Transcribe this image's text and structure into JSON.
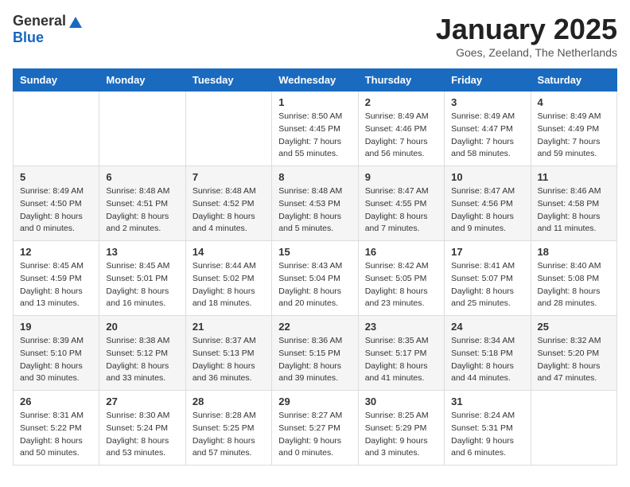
{
  "logo": {
    "general": "General",
    "blue": "Blue"
  },
  "title": "January 2025",
  "subtitle": "Goes, Zeeland, The Netherlands",
  "days_of_week": [
    "Sunday",
    "Monday",
    "Tuesday",
    "Wednesday",
    "Thursday",
    "Friday",
    "Saturday"
  ],
  "weeks": [
    [
      {
        "day": "",
        "sunrise": "",
        "sunset": "",
        "daylight": ""
      },
      {
        "day": "",
        "sunrise": "",
        "sunset": "",
        "daylight": ""
      },
      {
        "day": "",
        "sunrise": "",
        "sunset": "",
        "daylight": ""
      },
      {
        "day": "1",
        "sunrise": "Sunrise: 8:50 AM",
        "sunset": "Sunset: 4:45 PM",
        "daylight": "Daylight: 7 hours and 55 minutes."
      },
      {
        "day": "2",
        "sunrise": "Sunrise: 8:49 AM",
        "sunset": "Sunset: 4:46 PM",
        "daylight": "Daylight: 7 hours and 56 minutes."
      },
      {
        "day": "3",
        "sunrise": "Sunrise: 8:49 AM",
        "sunset": "Sunset: 4:47 PM",
        "daylight": "Daylight: 7 hours and 58 minutes."
      },
      {
        "day": "4",
        "sunrise": "Sunrise: 8:49 AM",
        "sunset": "Sunset: 4:49 PM",
        "daylight": "Daylight: 7 hours and 59 minutes."
      }
    ],
    [
      {
        "day": "5",
        "sunrise": "Sunrise: 8:49 AM",
        "sunset": "Sunset: 4:50 PM",
        "daylight": "Daylight: 8 hours and 0 minutes."
      },
      {
        "day": "6",
        "sunrise": "Sunrise: 8:48 AM",
        "sunset": "Sunset: 4:51 PM",
        "daylight": "Daylight: 8 hours and 2 minutes."
      },
      {
        "day": "7",
        "sunrise": "Sunrise: 8:48 AM",
        "sunset": "Sunset: 4:52 PM",
        "daylight": "Daylight: 8 hours and 4 minutes."
      },
      {
        "day": "8",
        "sunrise": "Sunrise: 8:48 AM",
        "sunset": "Sunset: 4:53 PM",
        "daylight": "Daylight: 8 hours and 5 minutes."
      },
      {
        "day": "9",
        "sunrise": "Sunrise: 8:47 AM",
        "sunset": "Sunset: 4:55 PM",
        "daylight": "Daylight: 8 hours and 7 minutes."
      },
      {
        "day": "10",
        "sunrise": "Sunrise: 8:47 AM",
        "sunset": "Sunset: 4:56 PM",
        "daylight": "Daylight: 8 hours and 9 minutes."
      },
      {
        "day": "11",
        "sunrise": "Sunrise: 8:46 AM",
        "sunset": "Sunset: 4:58 PM",
        "daylight": "Daylight: 8 hours and 11 minutes."
      }
    ],
    [
      {
        "day": "12",
        "sunrise": "Sunrise: 8:45 AM",
        "sunset": "Sunset: 4:59 PM",
        "daylight": "Daylight: 8 hours and 13 minutes."
      },
      {
        "day": "13",
        "sunrise": "Sunrise: 8:45 AM",
        "sunset": "Sunset: 5:01 PM",
        "daylight": "Daylight: 8 hours and 16 minutes."
      },
      {
        "day": "14",
        "sunrise": "Sunrise: 8:44 AM",
        "sunset": "Sunset: 5:02 PM",
        "daylight": "Daylight: 8 hours and 18 minutes."
      },
      {
        "day": "15",
        "sunrise": "Sunrise: 8:43 AM",
        "sunset": "Sunset: 5:04 PM",
        "daylight": "Daylight: 8 hours and 20 minutes."
      },
      {
        "day": "16",
        "sunrise": "Sunrise: 8:42 AM",
        "sunset": "Sunset: 5:05 PM",
        "daylight": "Daylight: 8 hours and 23 minutes."
      },
      {
        "day": "17",
        "sunrise": "Sunrise: 8:41 AM",
        "sunset": "Sunset: 5:07 PM",
        "daylight": "Daylight: 8 hours and 25 minutes."
      },
      {
        "day": "18",
        "sunrise": "Sunrise: 8:40 AM",
        "sunset": "Sunset: 5:08 PM",
        "daylight": "Daylight: 8 hours and 28 minutes."
      }
    ],
    [
      {
        "day": "19",
        "sunrise": "Sunrise: 8:39 AM",
        "sunset": "Sunset: 5:10 PM",
        "daylight": "Daylight: 8 hours and 30 minutes."
      },
      {
        "day": "20",
        "sunrise": "Sunrise: 8:38 AM",
        "sunset": "Sunset: 5:12 PM",
        "daylight": "Daylight: 8 hours and 33 minutes."
      },
      {
        "day": "21",
        "sunrise": "Sunrise: 8:37 AM",
        "sunset": "Sunset: 5:13 PM",
        "daylight": "Daylight: 8 hours and 36 minutes."
      },
      {
        "day": "22",
        "sunrise": "Sunrise: 8:36 AM",
        "sunset": "Sunset: 5:15 PM",
        "daylight": "Daylight: 8 hours and 39 minutes."
      },
      {
        "day": "23",
        "sunrise": "Sunrise: 8:35 AM",
        "sunset": "Sunset: 5:17 PM",
        "daylight": "Daylight: 8 hours and 41 minutes."
      },
      {
        "day": "24",
        "sunrise": "Sunrise: 8:34 AM",
        "sunset": "Sunset: 5:18 PM",
        "daylight": "Daylight: 8 hours and 44 minutes."
      },
      {
        "day": "25",
        "sunrise": "Sunrise: 8:32 AM",
        "sunset": "Sunset: 5:20 PM",
        "daylight": "Daylight: 8 hours and 47 minutes."
      }
    ],
    [
      {
        "day": "26",
        "sunrise": "Sunrise: 8:31 AM",
        "sunset": "Sunset: 5:22 PM",
        "daylight": "Daylight: 8 hours and 50 minutes."
      },
      {
        "day": "27",
        "sunrise": "Sunrise: 8:30 AM",
        "sunset": "Sunset: 5:24 PM",
        "daylight": "Daylight: 8 hours and 53 minutes."
      },
      {
        "day": "28",
        "sunrise": "Sunrise: 8:28 AM",
        "sunset": "Sunset: 5:25 PM",
        "daylight": "Daylight: 8 hours and 57 minutes."
      },
      {
        "day": "29",
        "sunrise": "Sunrise: 8:27 AM",
        "sunset": "Sunset: 5:27 PM",
        "daylight": "Daylight: 9 hours and 0 minutes."
      },
      {
        "day": "30",
        "sunrise": "Sunrise: 8:25 AM",
        "sunset": "Sunset: 5:29 PM",
        "daylight": "Daylight: 9 hours and 3 minutes."
      },
      {
        "day": "31",
        "sunrise": "Sunrise: 8:24 AM",
        "sunset": "Sunset: 5:31 PM",
        "daylight": "Daylight: 9 hours and 6 minutes."
      },
      {
        "day": "",
        "sunrise": "",
        "sunset": "",
        "daylight": ""
      }
    ]
  ]
}
